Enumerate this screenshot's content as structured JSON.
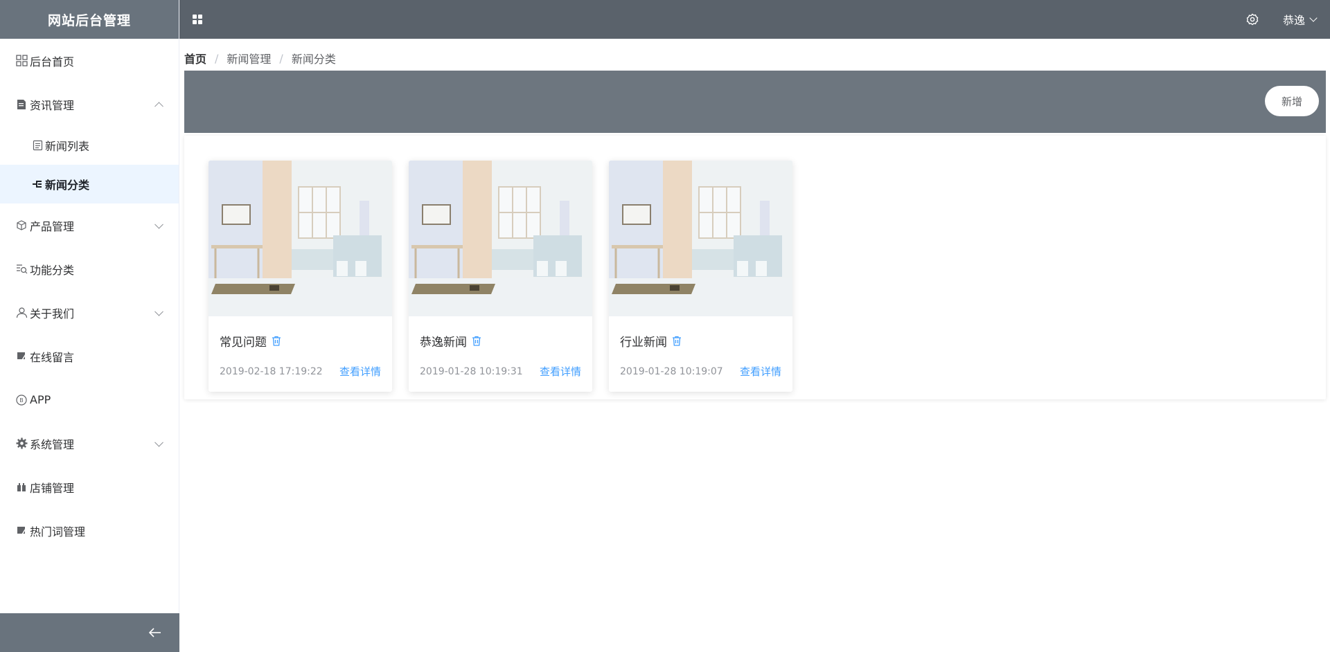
{
  "app": {
    "title": "网站后台管理"
  },
  "sidebar": {
    "items": [
      {
        "label": "后台首页",
        "icon": "dashboard-icon"
      },
      {
        "label": "资讯管理",
        "icon": "document-icon",
        "expanded": true,
        "children": [
          {
            "label": "新闻列表",
            "icon": "list-icon"
          },
          {
            "label": "新闻分类",
            "icon": "category-icon",
            "active": true
          }
        ]
      },
      {
        "label": "产品管理",
        "icon": "box-icon",
        "expanded": false
      },
      {
        "label": "功能分类",
        "icon": "search-list-icon"
      },
      {
        "label": "关于我们",
        "icon": "user-icon",
        "expanded": false
      },
      {
        "label": "在线留言",
        "icon": "message-icon"
      },
      {
        "label": "APP",
        "icon": "app-icon"
      },
      {
        "label": "系统管理",
        "icon": "gear-icon",
        "expanded": false
      },
      {
        "label": "店铺管理",
        "icon": "shop-icon"
      },
      {
        "label": "热门词管理",
        "icon": "hotword-icon"
      }
    ]
  },
  "header": {
    "user_name": "恭逸"
  },
  "breadcrumb": {
    "items": [
      "首页",
      "新闻管理",
      "新闻分类"
    ]
  },
  "toolbar": {
    "add_label": "新增"
  },
  "cards": [
    {
      "title": "常见问题",
      "date": "2019-02-18 17:19:22",
      "link": "查看详情"
    },
    {
      "title": "恭逸新闻",
      "date": "2019-01-28 10:19:31",
      "link": "查看详情"
    },
    {
      "title": "行业新闻",
      "date": "2019-01-28 10:19:07",
      "link": "查看详情"
    }
  ],
  "colors": {
    "sidebar_header": "#69737d",
    "topbar": "#5a626b",
    "toolbar": "#6d767f",
    "active_bg": "#ecf5ff",
    "link": "#409eff"
  }
}
